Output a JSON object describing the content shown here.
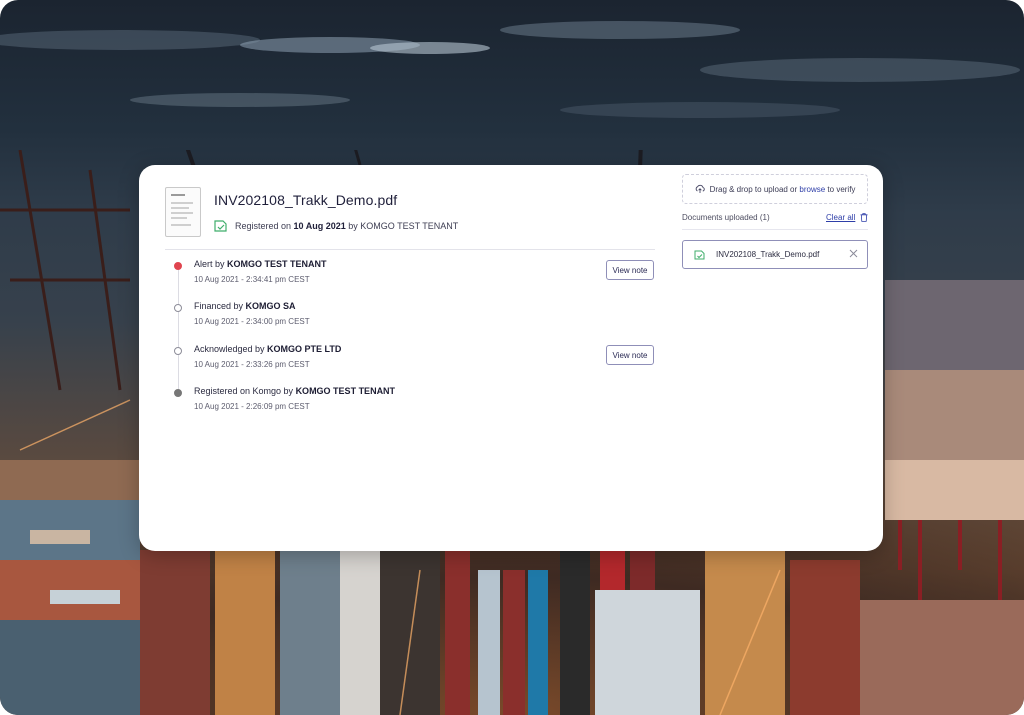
{
  "document": {
    "file_name": "INV202108_Trakk_Demo.pdf",
    "registered_prefix": "Registered on ",
    "registered_date": "10 Aug 2021",
    "registered_by_prefix": " by ",
    "registered_by": "KOMGO TEST TENANT"
  },
  "timeline": [
    {
      "action": "Alert by ",
      "actor": "KOMGO TEST TENANT",
      "time": "10 Aug 2021 - 2:34:41 pm CEST",
      "status": "alert",
      "button": "View note"
    },
    {
      "action": "Financed by ",
      "actor": "KOMGO SA",
      "time": "10 Aug 2021 - 2:34:00 pm CEST",
      "status": "open"
    },
    {
      "action": "Acknowledged by ",
      "actor": "KOMGO PTE LTD",
      "time": "10 Aug 2021 - 2:33:26 pm CEST",
      "status": "open",
      "button": "View note"
    },
    {
      "action": "Registered on Komgo by ",
      "actor": "KOMGO TEST TENANT",
      "time": "10 Aug 2021 - 2:26:09 pm CEST",
      "status": "registered"
    }
  ],
  "upload": {
    "drop_text_prefix": "Drag & drop to upload or ",
    "browse_link": "browse",
    "drop_text_suffix": " to verify",
    "documents_uploaded_label": "Documents uploaded (1)",
    "clear_all_label": "Clear all",
    "files": [
      "INV202108_Trakk_Demo.pdf"
    ]
  },
  "colors": {
    "alert_dot": "#e0454f",
    "link": "#2e3ea8",
    "button_border": "#8f8fb8",
    "icon_green": "#3fae6b"
  }
}
